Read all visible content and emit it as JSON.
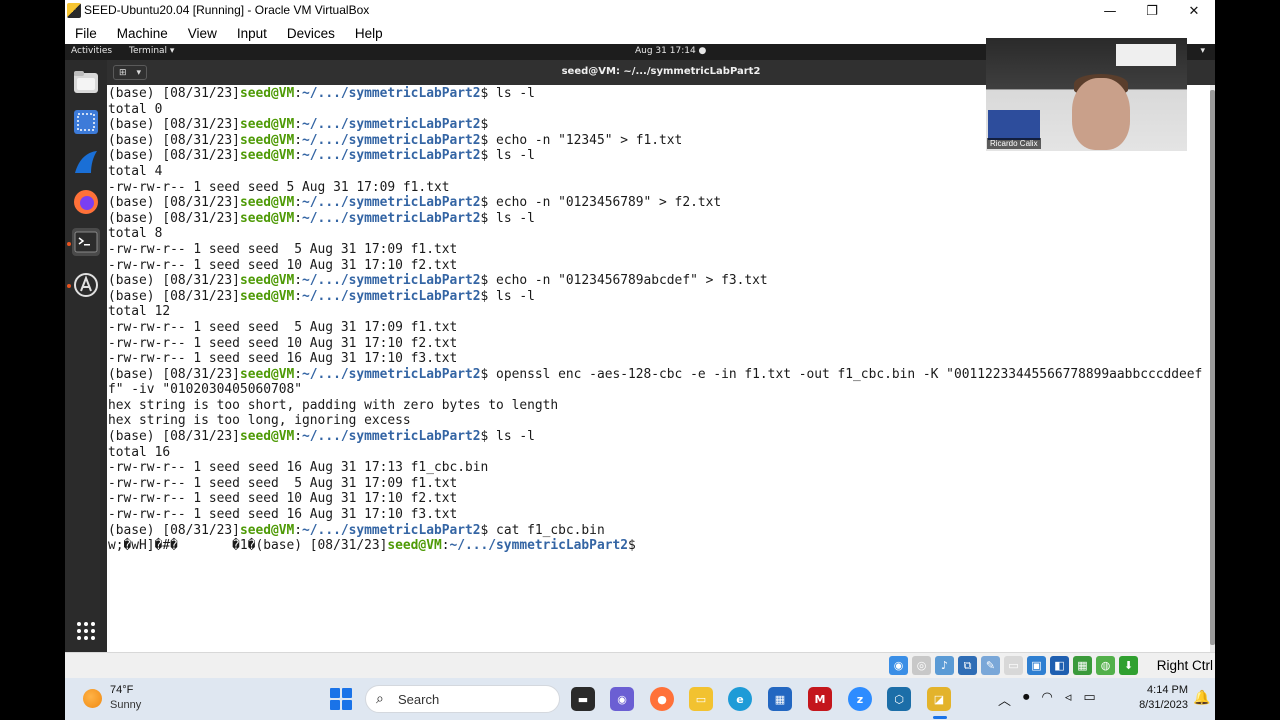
{
  "vbox": {
    "title": "SEED-Ubuntu20.04 [Running] - Oracle VM VirtualBox",
    "menus": [
      "File",
      "Machine",
      "View",
      "Input",
      "Devices",
      "Help"
    ],
    "minimize": "—",
    "restore": "❐",
    "close": "✕",
    "host_key": "Right Ctrl"
  },
  "ubuntu": {
    "activities": "Activities",
    "app_menu": "Terminal ▾",
    "clock": "Aug 31  17:14  ●",
    "tray": "▾"
  },
  "terminal": {
    "title": "seed@VM: ~/.../symmetricLabPart2",
    "lines": [
      {
        "pre": "(base) [08/31/23]",
        "user": "seed@VM",
        "colon": ":",
        "path": "~/.../symmetricLabPart2",
        "post": "$ ls -l"
      },
      {
        "text": "total 0"
      },
      {
        "pre": "(base) [08/31/23]",
        "user": "seed@VM",
        "colon": ":",
        "path": "~/.../symmetricLabPart2",
        "post": "$"
      },
      {
        "pre": "(base) [08/31/23]",
        "user": "seed@VM",
        "colon": ":",
        "path": "~/.../symmetricLabPart2",
        "post": "$ echo -n \"12345\" > f1.txt"
      },
      {
        "pre": "(base) [08/31/23]",
        "user": "seed@VM",
        "colon": ":",
        "path": "~/.../symmetricLabPart2",
        "post": "$ ls -l"
      },
      {
        "text": "total 4"
      },
      {
        "text": "-rw-rw-r-- 1 seed seed 5 Aug 31 17:09 f1.txt"
      },
      {
        "pre": "(base) [08/31/23]",
        "user": "seed@VM",
        "colon": ":",
        "path": "~/.../symmetricLabPart2",
        "post": "$ echo -n \"0123456789\" > f2.txt"
      },
      {
        "pre": "(base) [08/31/23]",
        "user": "seed@VM",
        "colon": ":",
        "path": "~/.../symmetricLabPart2",
        "post": "$ ls -l"
      },
      {
        "text": "total 8"
      },
      {
        "text": "-rw-rw-r-- 1 seed seed  5 Aug 31 17:09 f1.txt"
      },
      {
        "text": "-rw-rw-r-- 1 seed seed 10 Aug 31 17:10 f2.txt"
      },
      {
        "pre": "(base) [08/31/23]",
        "user": "seed@VM",
        "colon": ":",
        "path": "~/.../symmetricLabPart2",
        "post": "$ echo -n \"0123456789abcdef\" > f3.txt"
      },
      {
        "pre": "(base) [08/31/23]",
        "user": "seed@VM",
        "colon": ":",
        "path": "~/.../symmetricLabPart2",
        "post": "$ ls -l"
      },
      {
        "text": "total 12"
      },
      {
        "text": "-rw-rw-r-- 1 seed seed  5 Aug 31 17:09 f1.txt"
      },
      {
        "text": "-rw-rw-r-- 1 seed seed 10 Aug 31 17:10 f2.txt"
      },
      {
        "text": "-rw-rw-r-- 1 seed seed 16 Aug 31 17:10 f3.txt"
      },
      {
        "pre": "(base) [08/31/23]",
        "user": "seed@VM",
        "colon": ":",
        "path": "~/.../symmetricLabPart2",
        "post": "$ openssl enc -aes-128-cbc -e -in f1.txt -out f1_cbc.bin -K \"00112233445566778899aabbcccddeef"
      },
      {
        "text": "f\" -iv \"0102030405060708\""
      },
      {
        "text": "hex string is too short, padding with zero bytes to length"
      },
      {
        "text": "hex string is too long, ignoring excess"
      },
      {
        "pre": "(base) [08/31/23]",
        "user": "seed@VM",
        "colon": ":",
        "path": "~/.../symmetricLabPart2",
        "post": "$ ls -l"
      },
      {
        "text": "total 16"
      },
      {
        "text": "-rw-rw-r-- 1 seed seed 16 Aug 31 17:13 f1_cbc.bin"
      },
      {
        "text": "-rw-rw-r-- 1 seed seed  5 Aug 31 17:09 f1.txt"
      },
      {
        "text": "-rw-rw-r-- 1 seed seed 10 Aug 31 17:10 f2.txt"
      },
      {
        "text": "-rw-rw-r-- 1 seed seed 16 Aug 31 17:10 f3.txt"
      },
      {
        "pre": "(base) [08/31/23]",
        "user": "seed@VM",
        "colon": ":",
        "path": "~/.../symmetricLabPart2",
        "post": "$ cat f1_cbc.bin"
      },
      {
        "pre": "w;�wH]�#�       �1�(base) [08/31/23]",
        "user": "seed@VM",
        "colon": ":",
        "path": "~/.../symmetricLabPart2",
        "post": "$"
      }
    ]
  },
  "webcam": {
    "name": "Ricardo Calix"
  },
  "taskbar": {
    "temp": "74°F",
    "condition": "Sunny",
    "search": "Search",
    "time": "4:14 PM",
    "date": "8/31/2023"
  },
  "colors": {
    "prompt_user": "#4e9a06",
    "prompt_path": "#3465a4",
    "ubuntu_accent": "#e95420",
    "windows_accent": "#1a73e8"
  }
}
